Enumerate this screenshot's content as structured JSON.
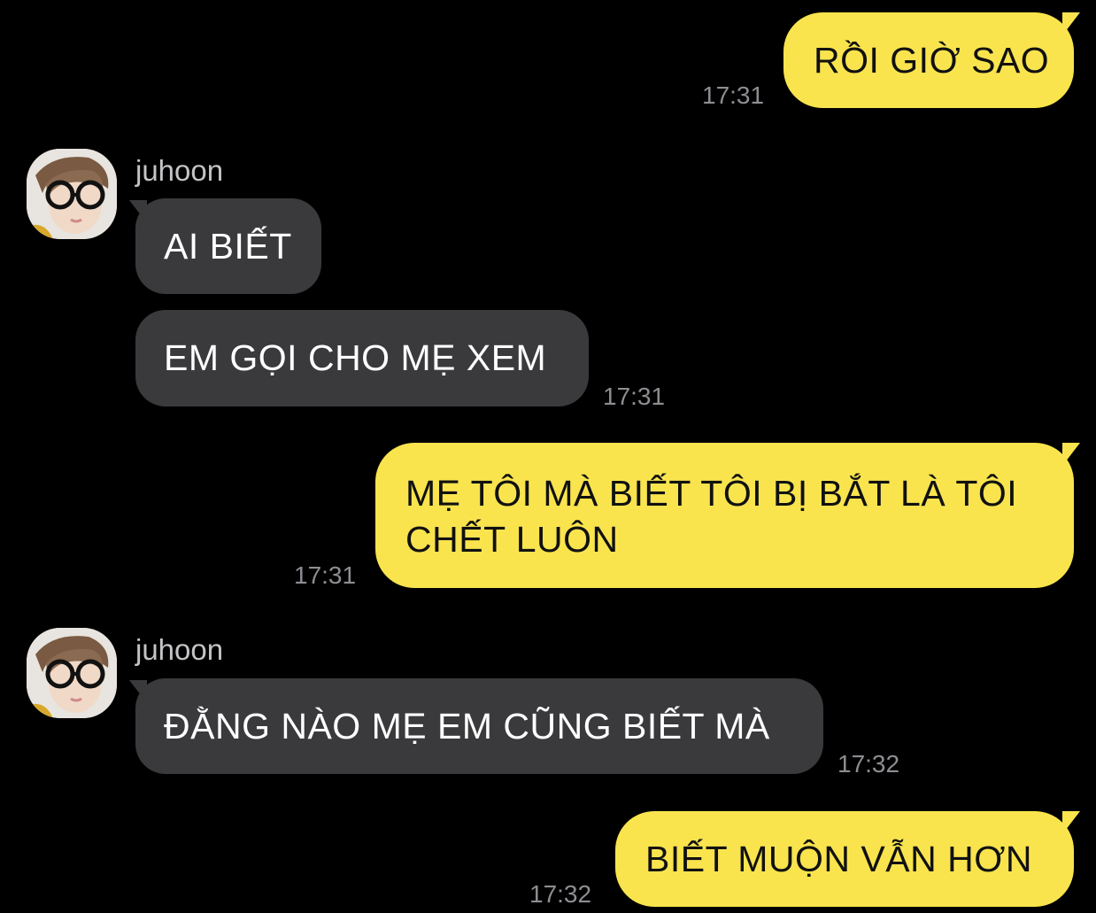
{
  "colors": {
    "background": "#000000",
    "my_bubble": "#f9e44e",
    "their_bubble": "#3a3a3c",
    "timestamp": "#8d8d92"
  },
  "messages": [
    {
      "from": "me",
      "text": "RỒI GIỜ SAO",
      "time": "17:31"
    },
    {
      "from": "juhoon",
      "sender": "juhoon",
      "text": "AI BIẾT"
    },
    {
      "from": "juhoon",
      "text": "EM GỌI CHO MẸ XEM",
      "time": "17:31"
    },
    {
      "from": "me",
      "text_lines": [
        "MẸ TÔI MÀ BIẾT TÔI BỊ BẮT LÀ TÔI",
        "CHẾT LUÔN"
      ],
      "time": "17:31"
    },
    {
      "from": "juhoon",
      "sender": "juhoon",
      "text": "ĐẰNG NÀO MẸ EM CŨNG BIẾT MÀ",
      "time": "17:32"
    },
    {
      "from": "me",
      "text": "BIẾT MUỘN VẪN HƠN",
      "time": "17:32"
    }
  ],
  "avatar_icon": "profile-photo-avatar"
}
